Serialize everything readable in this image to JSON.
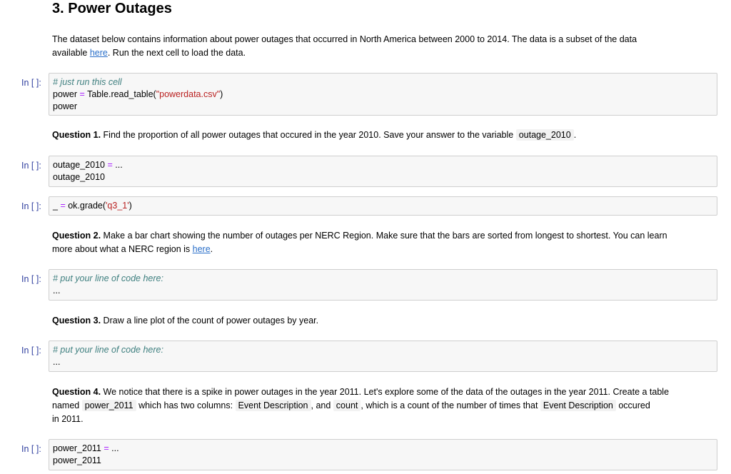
{
  "heading": "3. Power Outages",
  "intro": {
    "line1": "The dataset below contains information about power outages that occurred in North America between 2000 to 2014. The data is a subset of the data",
    "line2_pre": "available ",
    "line2_link": "here",
    "line2_post": ". Run the next cell to load the data."
  },
  "prompt_label": "In [ ]:",
  "cell1": {
    "comment": "# just run this cell",
    "l2_a": "power ",
    "l2_op": "=",
    "l2_b": " Table.read_table(",
    "l2_str": "\"powerdata.csv\"",
    "l2_c": ")",
    "l3": "power"
  },
  "q1": {
    "label": "Question 1.",
    "text": " Find the proportion of all power outages that occured in the year 2010. Save your answer to the variable ",
    "code": "outage_2010",
    "end": "."
  },
  "cell2": {
    "l1_a": "outage_2010 ",
    "l1_op": "=",
    "l1_b": " ...",
    "l2": "outage_2010"
  },
  "cell3": {
    "a": "_ ",
    "op": "=",
    "b": " ok.grade(",
    "str": "'q3_1'",
    "c": ")"
  },
  "q2": {
    "label": "Question 2.",
    "text": " Make a bar chart showing the number of outages per NERC Region. Make sure that the bars are sorted from longest to shortest. You can learn",
    "line2_pre": "more about what a NERC region is ",
    "line2_link": "here",
    "line2_post": "."
  },
  "cell4": {
    "comment": "# put your line of code here:",
    "l2": "..."
  },
  "q3": {
    "label": "Question 3.",
    "text": " Draw a line plot of the count of power outages by year."
  },
  "cell5": {
    "comment": "# put your line of code here:",
    "l2": "..."
  },
  "q4": {
    "label": "Question 4.",
    "text": " We notice that there is a spike in power outages in the year 2011. Let's explore some of the data of the outages in the year 2011. Create a table",
    "l2_a": "named ",
    "code1": "power_2011",
    "l2_b": " which has two columns: ",
    "code2": "Event Description",
    "l2_c": ", and ",
    "code3": "count",
    "l2_d": ", which is a count of the number of times that ",
    "code4": "Event Description",
    "l2_e": " occured",
    "l3": "in 2011."
  },
  "cell6": {
    "l1_a": "power_2011 ",
    "l1_op": "=",
    "l1_b": " ...",
    "l2": "power_2011"
  }
}
